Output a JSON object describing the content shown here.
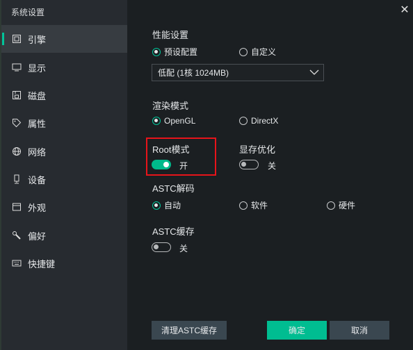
{
  "window": {
    "title": "系统设置",
    "close_icon": "close-icon"
  },
  "sidebar": {
    "items": [
      {
        "label": "引擎",
        "icon": "cpu-icon",
        "active": true
      },
      {
        "label": "显示",
        "icon": "monitor-icon"
      },
      {
        "label": "磁盘",
        "icon": "disk-icon"
      },
      {
        "label": "属性",
        "icon": "tag-icon"
      },
      {
        "label": "网络",
        "icon": "globe-icon"
      },
      {
        "label": "设备",
        "icon": "device-icon"
      },
      {
        "label": "外观",
        "icon": "window-icon"
      },
      {
        "label": "偏好",
        "icon": "wrench-icon"
      },
      {
        "label": "快捷键",
        "icon": "keyboard-icon"
      }
    ]
  },
  "performance": {
    "heading": "性能设置",
    "options": [
      "预设配置",
      "自定义"
    ],
    "selected": "预设配置",
    "preset_value": "低配 (1核 1024MB)"
  },
  "render": {
    "heading": "渲染模式",
    "options": [
      "OpenGL",
      "DirectX"
    ],
    "selected": "OpenGL"
  },
  "root": {
    "heading": "Root模式",
    "state": "开",
    "on": true
  },
  "vram": {
    "heading": "显存优化",
    "state": "关",
    "on": false
  },
  "astc_decode": {
    "heading": "ASTC解码",
    "options": [
      "自动",
      "软件",
      "硬件"
    ],
    "selected": "自动"
  },
  "astc_cache": {
    "heading": "ASTC缓存",
    "state": "关",
    "on": false
  },
  "buttons": {
    "clear": "清理ASTC缓存",
    "ok": "确定",
    "cancel": "取消"
  },
  "colors": {
    "accent": "#00c499",
    "highlight": "#e8141a"
  }
}
